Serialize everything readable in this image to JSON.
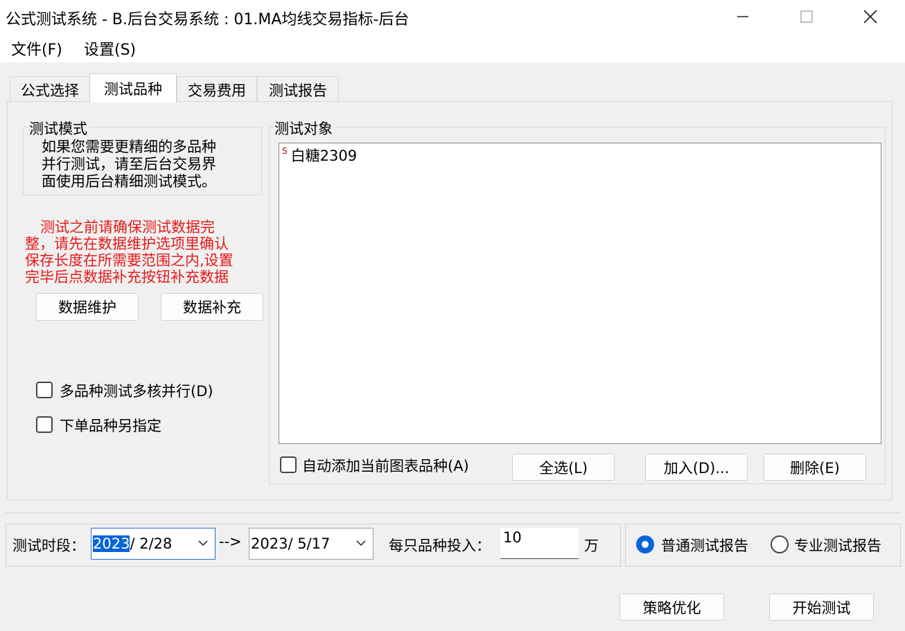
{
  "window": {
    "title": "公式测试系统 - B.后台交易系统 : 01.MA均线交易指标-后台"
  },
  "menu": {
    "items": [
      "文件(F)",
      "设置(S)"
    ]
  },
  "tabs": [
    {
      "label": "公式选择",
      "active": false
    },
    {
      "label": "测试品种",
      "active": true
    },
    {
      "label": "交易费用",
      "active": false
    },
    {
      "label": "测试报告",
      "active": false
    }
  ],
  "test_mode": {
    "legend": "测试模式",
    "lines": [
      "如果您需要更精细的多品种",
      "并行测试，请至后台交易界",
      "面使用后台精细测试模式。"
    ]
  },
  "warning": {
    "lines": [
      "测试之前请确保测试数据完",
      "整，请先在数据维护选项里确认",
      "保存长度在所需要范围之内,设置",
      "完毕后点数据补充按钮补充数据"
    ],
    "color": "#e61919"
  },
  "buttons": {
    "data_maintain": "数据维护",
    "data_supplement": "数据补充",
    "select_all": "全选(L)",
    "add": "加入(D)...",
    "delete": "删除(E)",
    "optimize": "策略优化",
    "start_test": "开始测试"
  },
  "checkboxes": {
    "multicore": {
      "label": "多品种测试多核并行(D)",
      "checked": false
    },
    "order_other": {
      "label": "下单品种另指定",
      "checked": false
    },
    "auto_add": {
      "label": "自动添加当前图表品种(A)",
      "checked": false
    }
  },
  "test_object": {
    "legend": "测试对象",
    "items": [
      {
        "badge": "S",
        "name": "白糖2309"
      }
    ]
  },
  "period": {
    "label": "测试时段：",
    "start_year": "2023",
    "start_rest": "/ 2/28",
    "arrow": "-->",
    "end": "2023/ 5/17",
    "invest_label": "每只品种投入：",
    "invest_value": "10",
    "unit": "万"
  },
  "report": {
    "normal": {
      "label": "普通测试报告",
      "selected": true
    },
    "pro": {
      "label": "专业测试报告",
      "selected": false
    }
  },
  "colors": {
    "accent": "#0a64d8",
    "warning": "#e61919",
    "badge": "#c00000"
  }
}
